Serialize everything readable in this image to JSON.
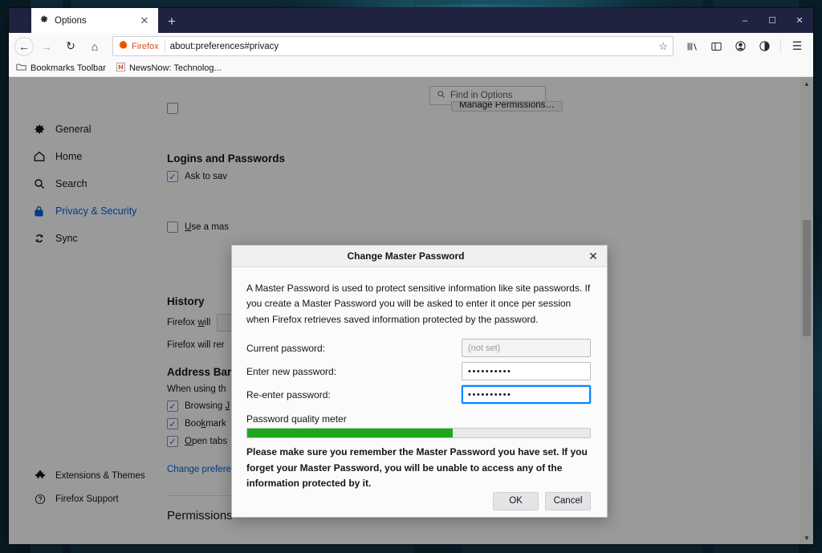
{
  "window": {
    "minimize_label": "–",
    "maximize_label": "☐",
    "close_label": "✕"
  },
  "tab": {
    "title": "Options",
    "icon": "gear-icon",
    "close_label": "✕",
    "newtab_label": "+"
  },
  "toolbar": {
    "back_label": "←",
    "forward_label": "→",
    "reload_label": "↻",
    "home_label": "⌂",
    "identity_name": "Firefox",
    "url": "about:preferences#privacy",
    "bookmark_star": "☆",
    "library_icon": "library-icon",
    "sidebar_icon": "sidebar-icon",
    "account_icon": "account-icon",
    "container_icon": "container-icon",
    "menu_label": "☰"
  },
  "bookmarks": [
    {
      "label": "Bookmarks Toolbar",
      "icon": "folder-icon"
    },
    {
      "label": "NewsNow: Technolog...",
      "icon": "newsnow-icon"
    }
  ],
  "sidebar": {
    "items": [
      {
        "label": "General",
        "icon": "gear-icon",
        "active": false
      },
      {
        "label": "Home",
        "icon": "home-icon",
        "active": false
      },
      {
        "label": "Search",
        "icon": "search-icon",
        "active": false
      },
      {
        "label": "Privacy & Security",
        "icon": "lock-icon",
        "active": true
      },
      {
        "label": "Sync",
        "icon": "sync-icon",
        "active": false
      }
    ],
    "bottom": [
      {
        "label": "Extensions & Themes",
        "icon": "puzzle-icon"
      },
      {
        "label": "Firefox Support",
        "icon": "help-icon"
      }
    ]
  },
  "search": {
    "placeholder": "Find in Options",
    "icon": "search-icon"
  },
  "main": {
    "manage_permissions_button": "Manage Permissions…",
    "logins_heading": "Logins and Passwords",
    "ask_to_save_label": "Ask to sav",
    "ask_to_save_checked": true,
    "use_master_label": "Use a mas",
    "use_master_checked": false,
    "history_heading": "History",
    "history_will_label": "Firefox will",
    "history_remember_label": "Firefox will rer",
    "addressbar_heading": "Address Bar",
    "addressbar_sub": "When using th",
    "addressbar_options": [
      {
        "label": "Browsing ",
        "checked": true
      },
      {
        "label": "Bookmark",
        "checked": true
      },
      {
        "label": "Open tabs",
        "checked": true
      }
    ],
    "search_prefs_link": "Change preferences for search engine suggestions",
    "permissions_heading": "Permissions"
  },
  "dialog": {
    "title": "Change Master Password",
    "close_label": "✕",
    "intro": "A Master Password is used to protect sensitive information like site passwords. If you create a Master Password you will be asked to enter it once per session when Firefox retrieves saved information protected by the password.",
    "fields": [
      {
        "label": "Current password:",
        "value": "(not set)",
        "state": "disabled"
      },
      {
        "label": "Enter new password:",
        "value": "••••••••••",
        "state": "normal"
      },
      {
        "label": "Re-enter password:",
        "value": "••••••••••",
        "state": "focused"
      }
    ],
    "meter_label": "Password quality meter",
    "meter_percent": 60,
    "meter_color": "#1ba81b",
    "warning": "Please make sure you remember the Master Password you have set. If you forget your Master Password, you will be unable to access any of the information protected by it.",
    "ok_label": "OK",
    "cancel_label": "Cancel"
  }
}
